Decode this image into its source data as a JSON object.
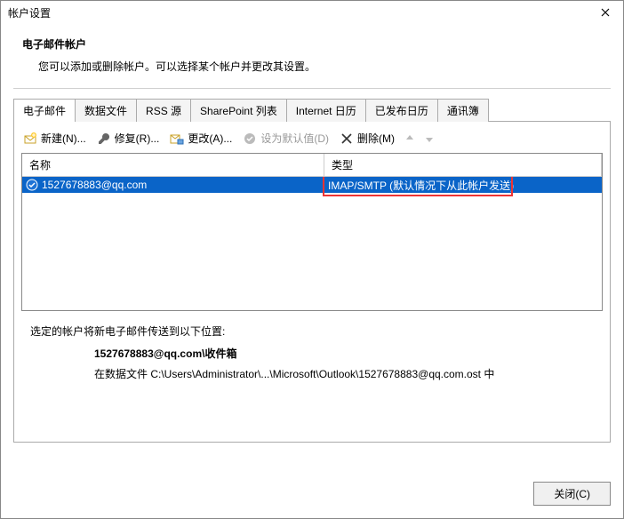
{
  "window": {
    "title": "帐户设置"
  },
  "header": {
    "title": "电子邮件帐户",
    "subtitle": "您可以添加或删除帐户。可以选择某个帐户并更改其设置。"
  },
  "tabs": [
    {
      "label": "电子邮件",
      "active": true
    },
    {
      "label": "数据文件",
      "active": false
    },
    {
      "label": "RSS 源",
      "active": false
    },
    {
      "label": "SharePoint 列表",
      "active": false
    },
    {
      "label": "Internet 日历",
      "active": false
    },
    {
      "label": "已发布日历",
      "active": false
    },
    {
      "label": "通讯簿",
      "active": false
    }
  ],
  "toolbar": {
    "new": "新建(N)...",
    "repair": "修复(R)...",
    "change": "更改(A)...",
    "default": "设为默认值(D)",
    "delete": "删除(M)"
  },
  "columns": {
    "name": "名称",
    "type": "类型"
  },
  "accounts": [
    {
      "name": "1527678883@qq.com",
      "type": "IMAP/SMTP (默认情况下从此帐户发送)"
    }
  ],
  "delivery": {
    "label": "选定的帐户将新电子邮件传送到以下位置:",
    "location": "1527678883@qq.com\\收件箱",
    "path": "在数据文件 C:\\Users\\Administrator\\...\\Microsoft\\Outlook\\1527678883@qq.com.ost 中"
  },
  "footer": {
    "close": "关闭(C)"
  }
}
